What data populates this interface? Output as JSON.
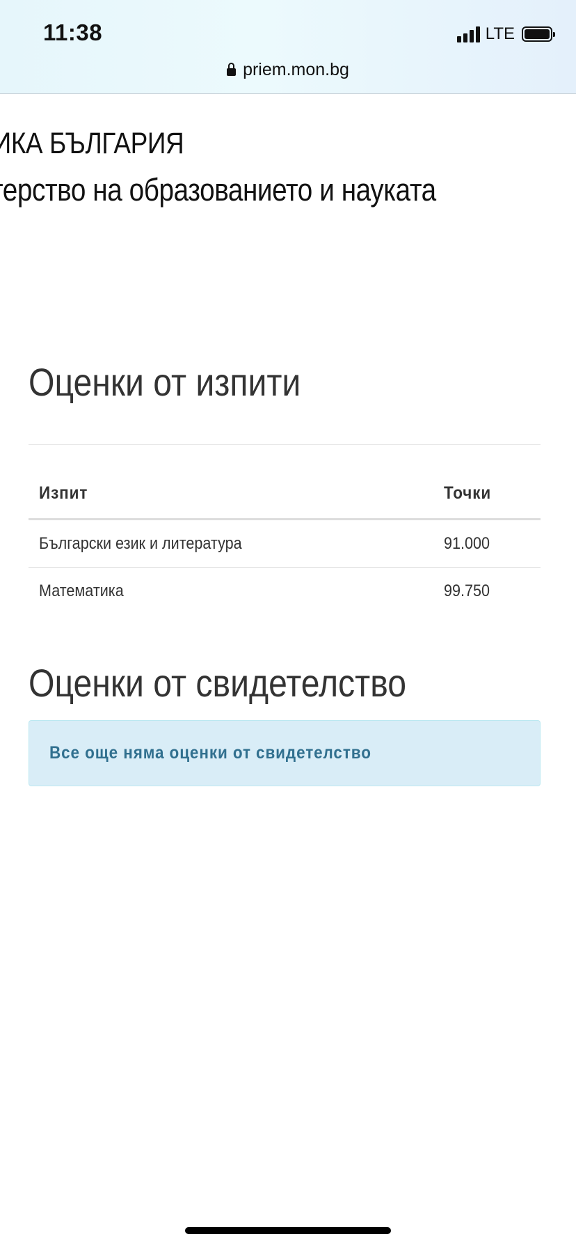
{
  "status_bar": {
    "time": "11:38",
    "network": "LTE",
    "icons": [
      "signal-icon",
      "battery-icon"
    ]
  },
  "address_bar": {
    "url": "priem.mon.bg",
    "icon": "lock-icon"
  },
  "header": {
    "line1": "БЛИКА БЪЛГАРИЯ",
    "line2": "стерство на образованието и науката"
  },
  "exams": {
    "title": "Оценки от изпити",
    "columns": [
      "Изпит",
      "Точки"
    ],
    "rows": [
      {
        "exam": "Български език и литература",
        "points": "91.000"
      },
      {
        "exam": "Математика",
        "points": "99.750"
      }
    ]
  },
  "certificate": {
    "title": "Оценки от свидетелство",
    "message": "Все още няма оценки от свидетелство"
  },
  "colors": {
    "alert_background": "#d9edf7",
    "alert_text": "#31708f",
    "text": "#333333"
  }
}
